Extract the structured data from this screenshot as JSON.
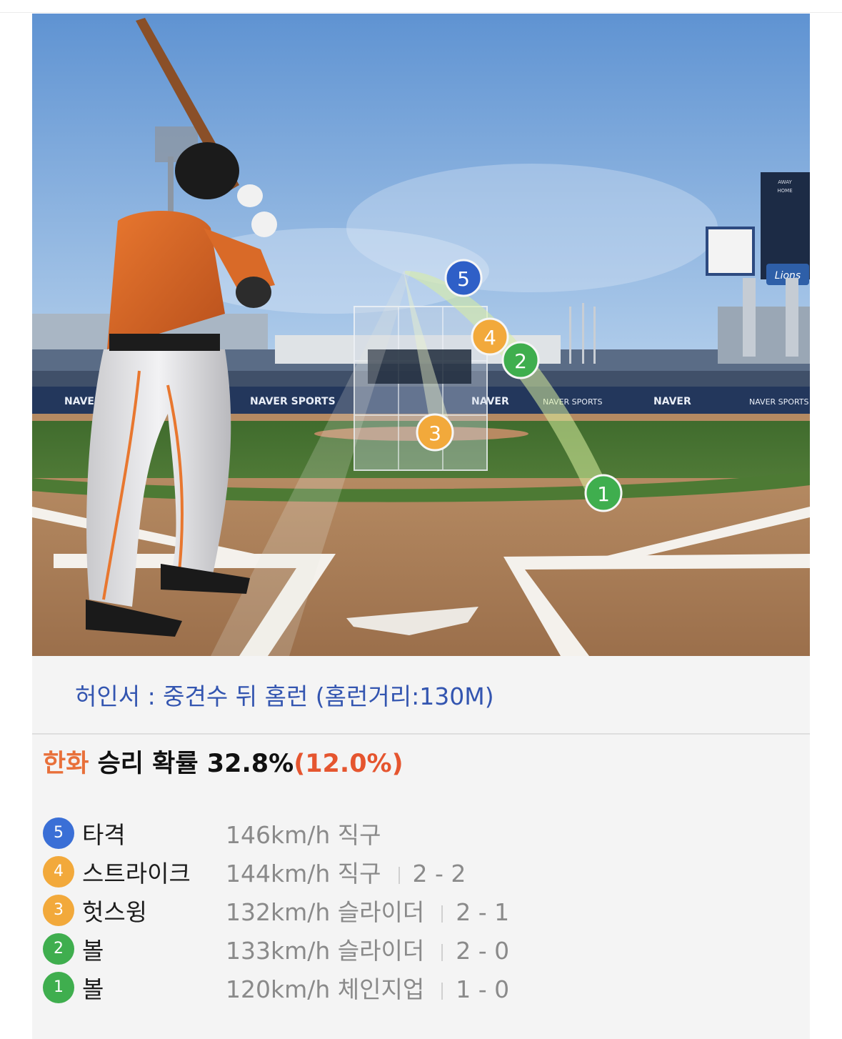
{
  "scoreboard": {
    "away": "AWAY",
    "home": "HOME",
    "logo": "Lions"
  },
  "ads": {
    "board1": "NAVER",
    "board2": "NAVER SPORTS",
    "board3": "NAVER",
    "board4": "NAVER SPORTS",
    "board5": "NAVER",
    "board6": "NAVER SPORTS"
  },
  "markers": [
    {
      "num": "1",
      "color": "#3fae4e"
    },
    {
      "num": "2",
      "color": "#3fae4e"
    },
    {
      "num": "3",
      "color": "#f2a93b"
    },
    {
      "num": "4",
      "color": "#f2a93b"
    },
    {
      "num": "5",
      "color": "#2f5fc7"
    }
  ],
  "result": {
    "text": "허인서 : 중견수 뒤 홈런 (홈런거리:130M)"
  },
  "win_probability": {
    "team": "한화",
    "label": " 승리 확률 ",
    "value": "32.8%",
    "delta": "(12.0%)"
  },
  "pitches": [
    {
      "num": "5",
      "color": "#3a6fd6",
      "result": "타격",
      "desc": "146km/h  직구",
      "count": ""
    },
    {
      "num": "4",
      "color": "#f2a93b",
      "result": "스트라이크",
      "desc": "144km/h  직구",
      "count": "2 - 2"
    },
    {
      "num": "3",
      "color": "#f2a93b",
      "result": "헛스윙",
      "desc": "132km/h  슬라이더",
      "count": "2 - 1"
    },
    {
      "num": "2",
      "color": "#3fae4e",
      "result": "볼",
      "desc": "133km/h  슬라이더",
      "count": "2 - 0"
    },
    {
      "num": "1",
      "color": "#3fae4e",
      "result": "볼",
      "desc": "120km/h  체인지업",
      "count": "1 - 0"
    }
  ]
}
